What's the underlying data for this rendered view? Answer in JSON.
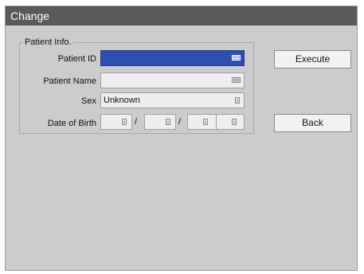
{
  "window": {
    "title": "Change"
  },
  "patient_info": {
    "legend": "Patient Info.",
    "patient_id": {
      "label": "Patient ID",
      "value": ""
    },
    "patient_name": {
      "label": "Patient Name",
      "value": ""
    },
    "sex": {
      "label": "Sex",
      "value": "Unknown"
    },
    "date_of_birth": {
      "label": "Date of Birth",
      "separator": "/"
    }
  },
  "buttons": {
    "execute": "Execute",
    "back": "Back"
  },
  "colors": {
    "titlebar": "#5a5a5a",
    "window_bg": "#cccccc",
    "selected_field": "#2f4fb0"
  },
  "icons": [
    "keyboard-icon",
    "list-icon"
  ]
}
